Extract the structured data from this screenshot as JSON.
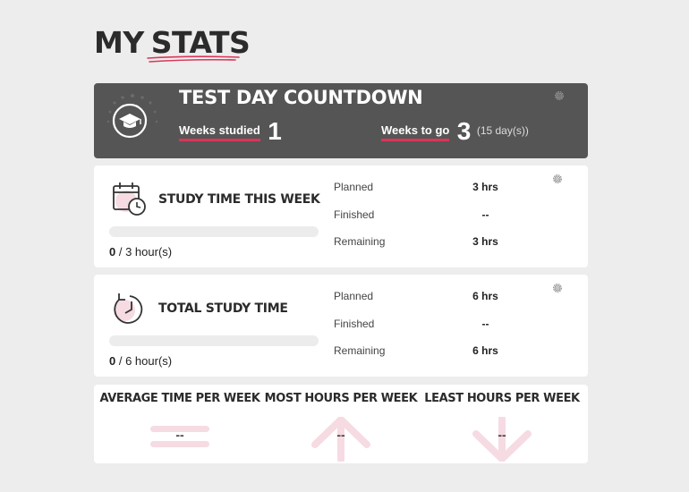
{
  "header": {
    "title_part1": "MY",
    "title_part2": "STATS"
  },
  "countdown": {
    "title": "TEST DAY COUNTDOWN",
    "weeks_studied_label": "Weeks studied",
    "weeks_studied_value": "1",
    "weeks_to_go_label": "Weeks to go",
    "weeks_to_go_value": "3",
    "days_note": "(15 day(s))"
  },
  "study_week": {
    "title": "STUDY TIME THIS WEEK",
    "progress_done": "0",
    "progress_total": "/ 3 hour(s)",
    "progress_fraction": 0,
    "rows": [
      {
        "label": "Planned",
        "value": "3 hrs"
      },
      {
        "label": "Finished",
        "value": "--"
      },
      {
        "label": "Remaining",
        "value": "3 hrs"
      }
    ]
  },
  "total_study": {
    "title": "TOTAL STUDY TIME",
    "progress_done": "0",
    "progress_total": "/ 6 hour(s)",
    "progress_fraction": 0,
    "rows": [
      {
        "label": "Planned",
        "value": "6 hrs"
      },
      {
        "label": "Finished",
        "value": "--"
      },
      {
        "label": "Remaining",
        "value": "6 hrs"
      }
    ]
  },
  "metrics": [
    {
      "title": "AVERAGE TIME PER WEEK",
      "value": "--",
      "icon": "equals-icon"
    },
    {
      "title": "MOST HOURS PER WEEK",
      "value": "--",
      "icon": "arrow-up-icon"
    },
    {
      "title": "LEAST HOURS PER WEEK",
      "value": "--",
      "icon": "arrow-down-icon"
    }
  ],
  "colors": {
    "accent": "#d9365a",
    "accent_light": "#f6dbe2",
    "dark_card": "#555555",
    "background": "#ededed"
  }
}
